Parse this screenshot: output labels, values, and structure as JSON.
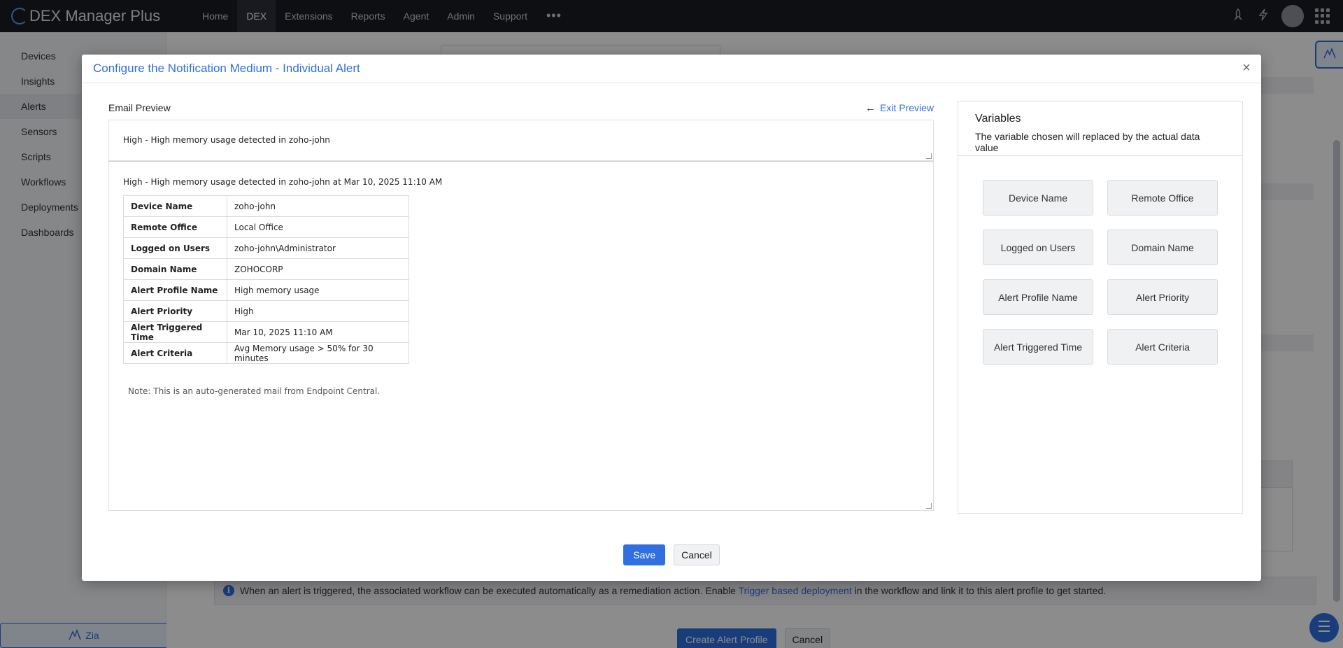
{
  "app": {
    "brand": "DEX Manager Plus"
  },
  "nav": {
    "items": [
      "Home",
      "DEX",
      "Extensions",
      "Reports",
      "Agent",
      "Admin",
      "Support"
    ],
    "active": "DEX"
  },
  "sidebar": {
    "items": [
      "Devices",
      "Insights",
      "Alerts",
      "Sensors",
      "Scripts",
      "Workflows",
      "Deployments",
      "Dashboards"
    ],
    "active": "Alerts",
    "zia_label": "Zia"
  },
  "background": {
    "info_text_before": "When an alert is triggered, the associated workflow can be executed automatically as a remediation action. Enable ",
    "info_link": "Trigger based deployment",
    "info_text_after": " in the workflow and link it to this alert profile to get started.",
    "create_button": "Create Alert Profile",
    "cancel_button": "Cancel"
  },
  "modal": {
    "title": "Configure the Notification Medium - Individual Alert",
    "preview_label": "Email Preview",
    "exit_preview": "Exit Preview",
    "subject": "High - High memory usage detected in zoho-john",
    "body_intro": "High - High memory usage detected in zoho-john at Mar 10, 2025 11:10 AM",
    "details": [
      {
        "key": "Device Name",
        "value": "zoho-john"
      },
      {
        "key": "Remote Office",
        "value": "Local Office"
      },
      {
        "key": "Logged on Users",
        "value": "zoho-john\\Administrator"
      },
      {
        "key": "Domain Name",
        "value": "ZOHOCORP"
      },
      {
        "key": "Alert Profile Name",
        "value": "High memory usage"
      },
      {
        "key": "Alert Priority",
        "value": "High"
      },
      {
        "key": "Alert Triggered Time",
        "value": "Mar 10, 2025 11:10 AM"
      },
      {
        "key": "Alert Criteria",
        "value": "Avg Memory usage > 50% for 30 minutes"
      }
    ],
    "note": "Note: This is an auto-generated mail from Endpoint Central.",
    "variables": {
      "title": "Variables",
      "description": "The variable chosen will replaced by the actual data value",
      "items": [
        "Device Name",
        "Remote Office",
        "Logged on Users",
        "Domain Name",
        "Alert Profile Name",
        "Alert Priority",
        "Alert Triggered Time",
        "Alert Criteria"
      ]
    },
    "save_button": "Save",
    "cancel_button": "Cancel"
  },
  "icons": {
    "rocket": "rocket-icon",
    "lightning": "lightning-icon",
    "apps": "apps-grid-icon",
    "close": "close-icon",
    "back_arrow": "arrow-left-icon",
    "info": "info-icon",
    "zia": "zia-icon",
    "menu": "menu-icon"
  },
  "colors": {
    "accent": "#2f6fe0",
    "topbar": "#1a1d24"
  }
}
